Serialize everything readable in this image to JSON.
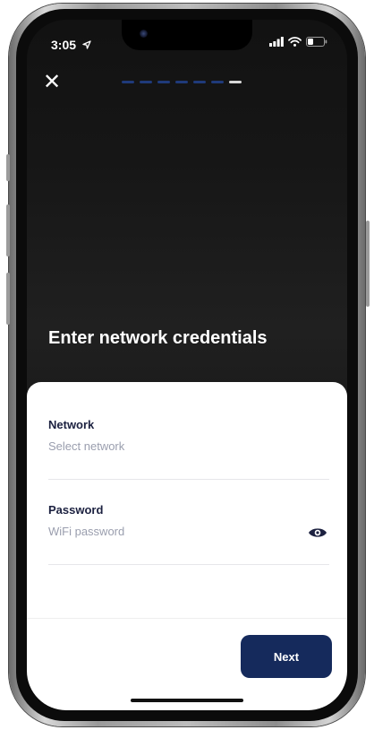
{
  "status_bar": {
    "time": "3:05",
    "location_icon": "location-arrow-icon",
    "signal_icon": "cellular-signal-icon",
    "wifi_icon": "wifi-icon",
    "battery_icon": "battery-icon"
  },
  "header": {
    "close_icon": "close-icon",
    "close_label": "✕",
    "progress": {
      "total_steps": 7,
      "completed_steps": 6,
      "active_color": "#1f3a7a",
      "inactive_color": "#d8d8d8"
    }
  },
  "title": "Enter network credentials",
  "form": {
    "network": {
      "label": "Network",
      "placeholder": "Select network"
    },
    "password": {
      "label": "Password",
      "placeholder": "WiFi password",
      "toggle_icon": "eye-icon"
    }
  },
  "footer": {
    "next_label": "Next"
  },
  "colors": {
    "accent": "#152a5c",
    "sheet_background": "#ffffff",
    "screen_background": "#161616"
  }
}
